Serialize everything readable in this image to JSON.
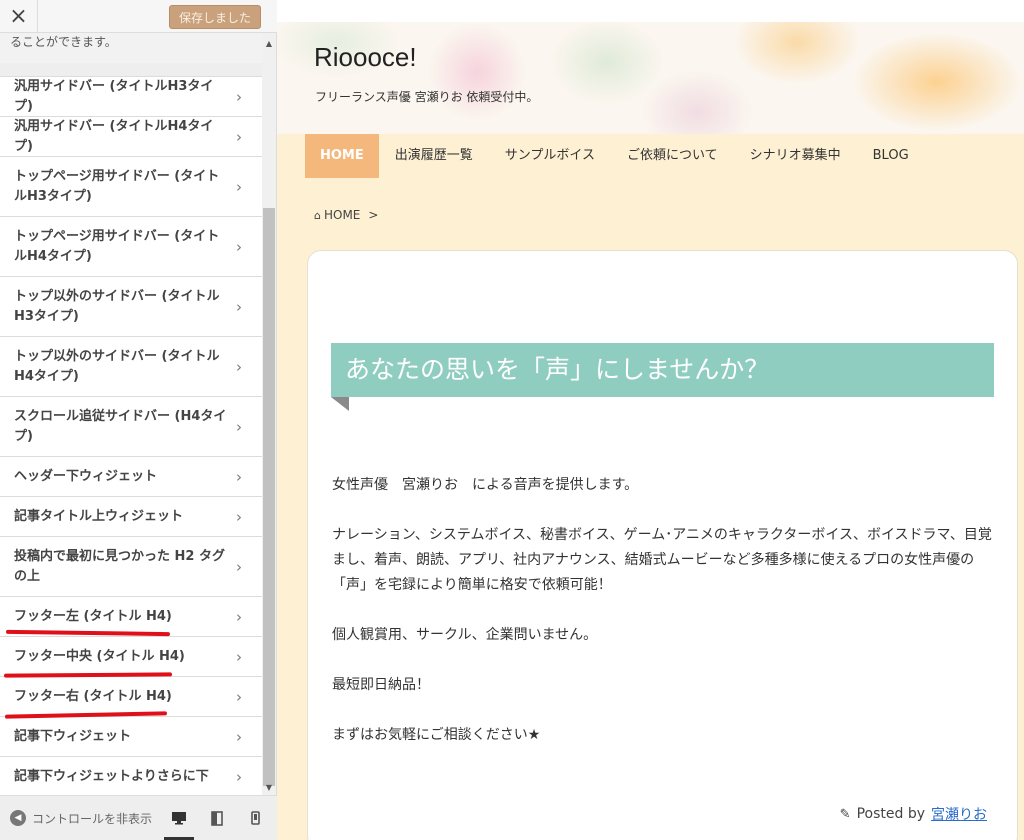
{
  "panel": {
    "close_icon": "×",
    "saved_label": "保存しました",
    "description": "ることができます。",
    "widgets": [
      {
        "label": "汎用サイドバー (タイトルH3タイプ)",
        "tall": false
      },
      {
        "label": "汎用サイドバー (タイトルH4タイプ)",
        "tall": false
      },
      {
        "label": "トップページ用サイドバー (タイトルH3タイプ)",
        "tall": true
      },
      {
        "label": "トップページ用サイドバー (タイトルH4タイプ)",
        "tall": true
      },
      {
        "label": "トップ以外のサイドバー (タイトルH3タイプ)",
        "tall": true
      },
      {
        "label": "トップ以外のサイドバー (タイトルH4タイプ)",
        "tall": true
      },
      {
        "label": "スクロール追従サイドバー (H4タイプ)",
        "tall": true
      },
      {
        "label": "ヘッダー下ウィジェット",
        "tall": false
      },
      {
        "label": "記事タイトル上ウィジェット",
        "tall": false
      },
      {
        "label": "投稿内で最初に見つかった H2 タグの上",
        "tall": true
      },
      {
        "label": "フッター左 (タイトル H4)",
        "tall": false
      },
      {
        "label": "フッター中央 (タイトル H4)",
        "tall": false
      },
      {
        "label": "フッター右 (タイトル H4)",
        "tall": false
      },
      {
        "label": "記事下ウィジェット",
        "tall": false
      },
      {
        "label": "記事下ウィジェットよりさらに下",
        "tall": false
      }
    ],
    "chevron": "›",
    "footer": {
      "hide_label": "コントロールを非表示",
      "devices": [
        "desktop-icon",
        "tablet-icon",
        "mobile-icon"
      ],
      "active_device": "desktop"
    }
  },
  "site": {
    "title": "Rioooce!",
    "description": "フリーランス声優 宮瀬りお 依頼受付中。",
    "nav": [
      "HOME",
      "出演履歴一覧",
      "サンプルボイス",
      "ご依頼について",
      "シナリオ募集中",
      "BLOG"
    ],
    "nav_active": 0,
    "breadcrumb": {
      "home": "HOME",
      "sep": ">"
    },
    "headline": "あなたの思いを「声」にしませんか？",
    "paragraphs": [
      "女性声優　宮瀬りお　による音声を提供します。",
      "ナレーション、システムボイス、秘書ボイス、ゲーム･アニメのキャラクターボイス、ボイスドラマ、目覚まし、着声、朗読、アプリ、社内アナウンス、結婚式ムービーなど多種多様に使えるプロの女性声優の「声」を宅録により簡単に格安で依頼可能！",
      "個人観賞用、サークル、企業問いません。",
      "最短即日納品！",
      "まずはお気軽にご相談ください★"
    ],
    "posted_by": "Posted by",
    "author": "宮瀬りお"
  },
  "colors": {
    "accent_nav": "#f4b77c",
    "headline_band": "#8fcdc0",
    "annotation_red": "#e0101b",
    "saved_button": "#c9a17c"
  }
}
